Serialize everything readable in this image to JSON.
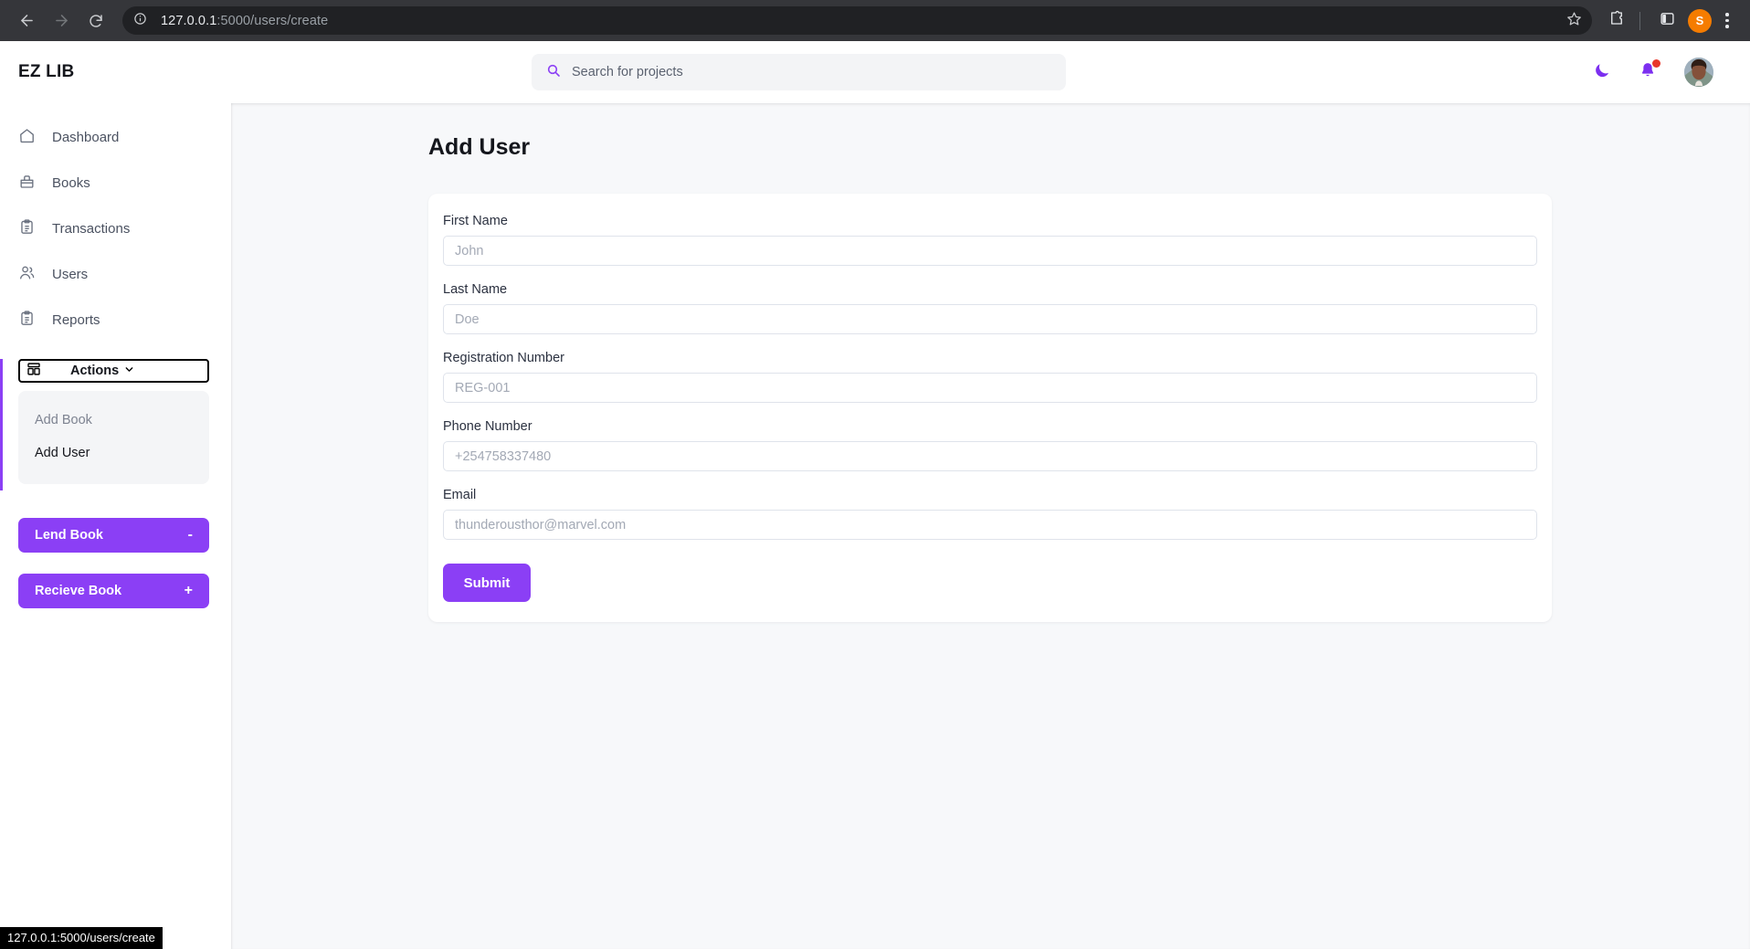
{
  "browser": {
    "back_icon": "arrow-left-icon",
    "forward_icon": "arrow-right-icon",
    "reload_icon": "reload-icon",
    "site_info_icon": "info-circle-icon",
    "url_host": "127.0.0.1",
    "url_path": ":5000/users/create",
    "url_full": "127.0.0.1:5000/users/create",
    "star_icon": "bookmark-star-icon",
    "extensions_icon": "extensions-puzzle-icon",
    "side_panel_icon": "side-panel-icon",
    "profile_initial": "S",
    "menu_icon": "three-dot-menu-icon"
  },
  "topbar": {
    "brand": "EZ LIB",
    "search": {
      "placeholder": "Search for projects",
      "icon": "search-icon",
      "value": ""
    },
    "theme_toggle_icon": "moon-icon",
    "notifications_icon": "bell-icon",
    "notifications_has_unread": true,
    "avatar_icon": "user-avatar"
  },
  "sidebar": {
    "items": [
      {
        "label": "Dashboard",
        "icon": "home-icon"
      },
      {
        "label": "Books",
        "icon": "briefcase-icon"
      },
      {
        "label": "Transactions",
        "icon": "clipboard-list-icon"
      },
      {
        "label": "Users",
        "icon": "users-icon"
      },
      {
        "label": "Reports",
        "icon": "clipboard-list-icon"
      }
    ],
    "actions": {
      "label": "Actions",
      "icon": "layout-grid-icon",
      "chevron": "chevron-down-icon",
      "expanded": true,
      "menu": [
        {
          "label": "Add Book",
          "state": "muted"
        },
        {
          "label": "Add User",
          "state": "active"
        }
      ]
    },
    "buttons": [
      {
        "label": "Lend Book",
        "sign": "-"
      },
      {
        "label": "Recieve Book",
        "sign": "+"
      }
    ],
    "accent_color": "#8b3ff5"
  },
  "main": {
    "page_title": "Add User",
    "form": {
      "fields": [
        {
          "label": "First Name",
          "placeholder": "John",
          "value": ""
        },
        {
          "label": "Last Name",
          "placeholder": "Doe",
          "value": ""
        },
        {
          "label": "Registration Number",
          "placeholder": "REG-001",
          "value": ""
        },
        {
          "label": "Phone Number",
          "placeholder": "+254758337480",
          "value": ""
        },
        {
          "label": "Email",
          "placeholder": "thunderousthor@marvel.com",
          "value": ""
        }
      ],
      "submit_label": "Submit"
    }
  },
  "status_bar": {
    "text": "127.0.0.1:5000/users/create"
  },
  "colors": {
    "accent": "#8b3ff5",
    "badge": "#e8362a",
    "main_bg": "#f7f8fa",
    "profile_chip": "#f57c00"
  }
}
